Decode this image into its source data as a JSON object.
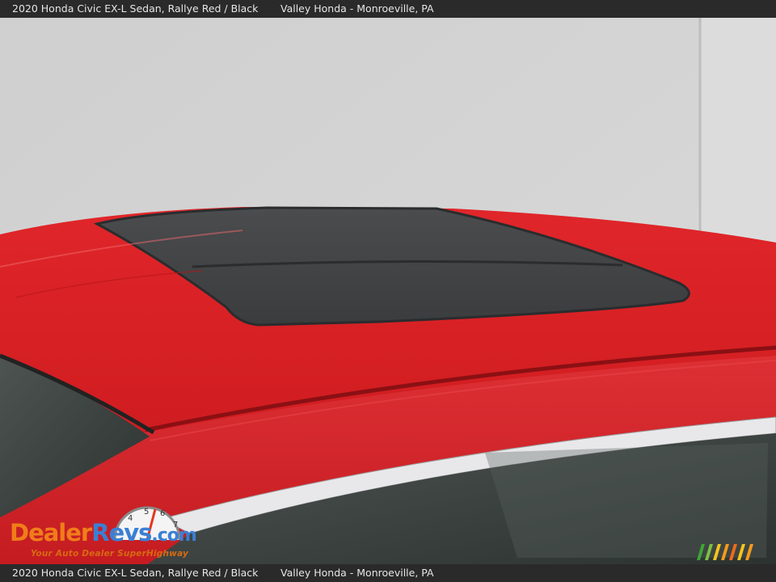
{
  "caption": {
    "vehicle": "2020 Honda Civic EX-L Sedan,  Rallye Red / Black",
    "dealer": "Valley Honda - Monroeville, PA"
  },
  "watermark": {
    "brand_part1": "Dealer",
    "brand_part2": "Revs",
    "brand_suffix": ".com",
    "tagline": "Your Auto Dealer SuperHighway"
  },
  "colors": {
    "car_red": "#d41f22",
    "sunroof_glass": "#3a3d40",
    "wall": "#d3d3d3",
    "caption_bar": "#2a2a2a",
    "logo_orange": "#f07d1a",
    "logo_blue": "#3b7fd4"
  },
  "icons": [
    "speedometer-icon",
    "color-stripes-icon"
  ]
}
